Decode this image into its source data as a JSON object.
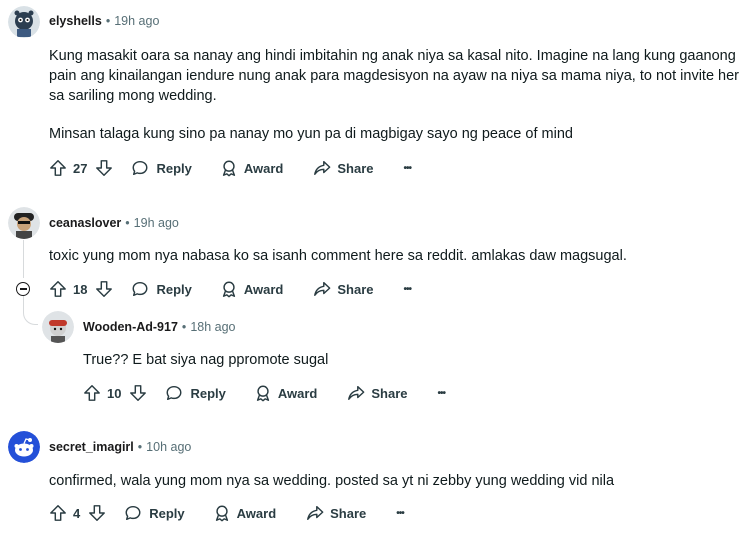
{
  "comments": [
    {
      "username": "elyshells",
      "time": "19h ago",
      "paragraphs": [
        "Kung masakit oara sa nanay ang hindi imbitahin ng anak niya sa kasal nito. Imagine na lang kung gaanong pain ang kinailangan iendure nung anak para magdesisyon na ayaw na niya sa mama niya, to not invite her sa sariling mong wedding.",
        "Minsan talaga kung sino pa nanay mo yun pa di magbigay sayo ng peace of mind"
      ],
      "score": "27"
    },
    {
      "username": "ceanaslover",
      "time": "19h ago",
      "paragraphs": [
        "toxic yung mom nya nabasa ko sa isanh comment here sa reddit. amlakas daw magsugal."
      ],
      "score": "18"
    },
    {
      "username": "Wooden-Ad-917",
      "time": "18h ago",
      "paragraphs": [
        "True?? E bat siya nag ppromote sugal"
      ],
      "score": "10"
    },
    {
      "username": "secret_imagirl",
      "time": "10h ago",
      "paragraphs": [
        "confirmed, wala yung mom nya sa wedding. posted sa yt ni zebby yung wedding vid nila"
      ],
      "score": "4"
    }
  ],
  "labels": {
    "separator": "•",
    "reply": "Reply",
    "award": "Award",
    "share": "Share",
    "more": "•••"
  },
  "icons": [
    "upvote-icon",
    "downvote-icon",
    "reply-icon",
    "award-icon",
    "share-icon",
    "more-icon",
    "collapse-icon"
  ]
}
